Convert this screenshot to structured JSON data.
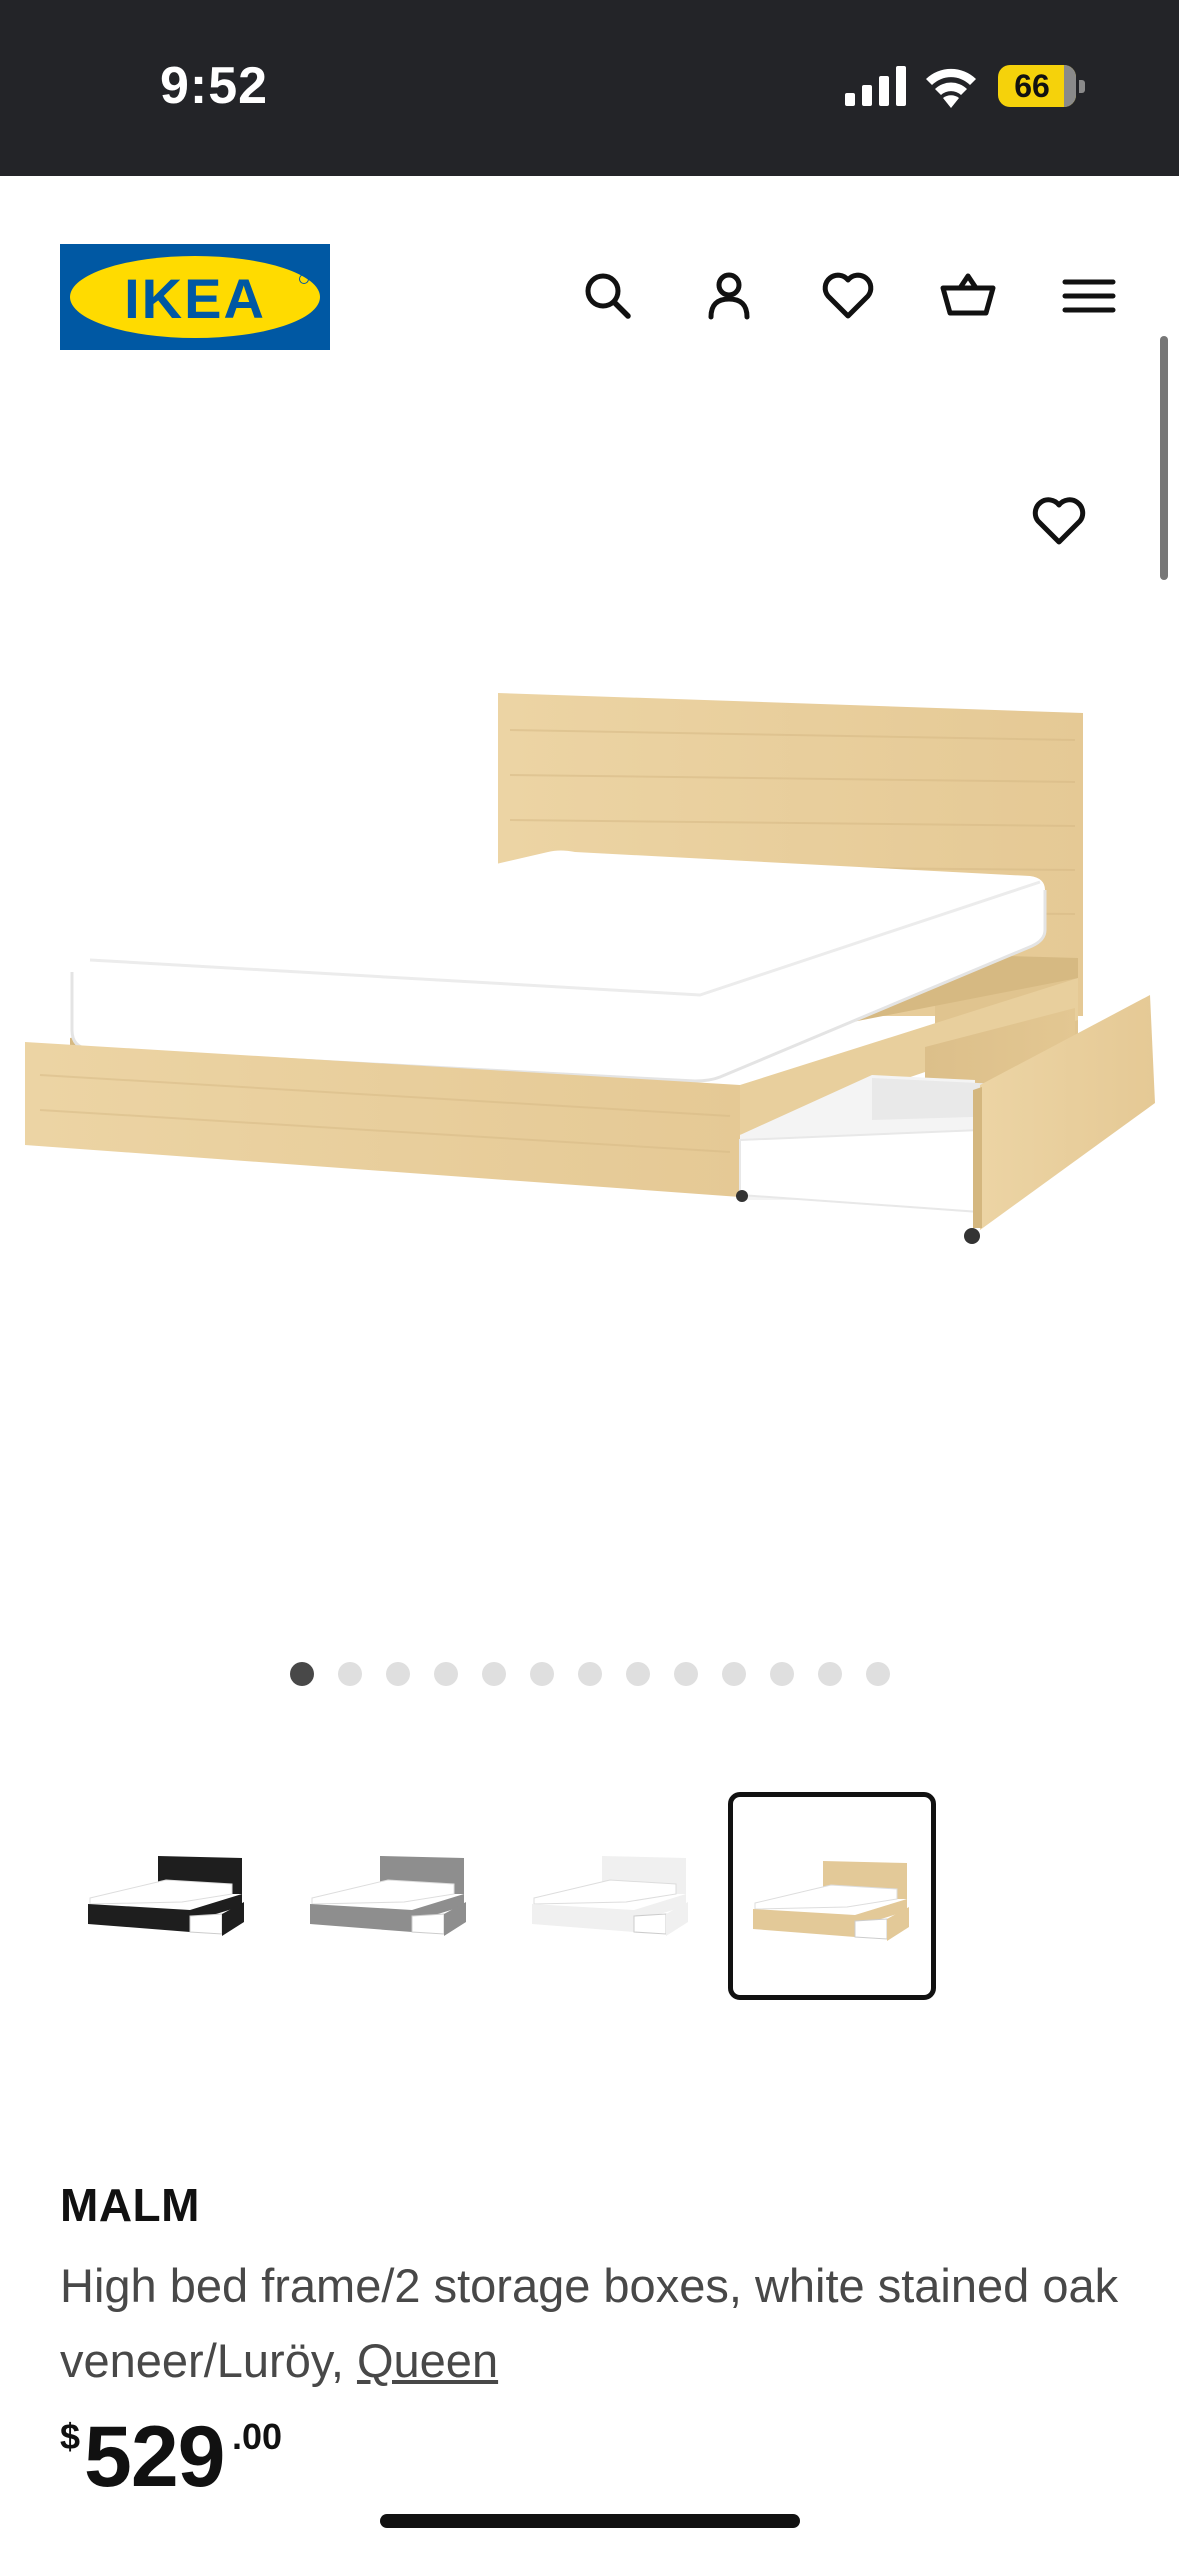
{
  "status_bar": {
    "time": "9:52",
    "battery": "66",
    "icons": [
      "signal-icon",
      "wifi-icon",
      "battery-icon"
    ]
  },
  "header": {
    "logo_text": "IKEA",
    "icons": [
      "search-icon",
      "account-icon",
      "heart-icon",
      "cart-icon",
      "menu-icon"
    ]
  },
  "gallery": {
    "total_images": 13,
    "active_index": 0,
    "wishlist_icon": "heart-icon"
  },
  "variants": [
    {
      "name": "black-brown",
      "color": "#1e1e1e",
      "selected": false
    },
    {
      "name": "gray",
      "color": "#8e8e8e",
      "selected": false
    },
    {
      "name": "white",
      "color": "#f0f0f0",
      "selected": false
    },
    {
      "name": "white stained oak veneer",
      "color": "#e3c998",
      "selected": true
    }
  ],
  "product": {
    "name": "MALM",
    "description": "High bed frame/2 storage boxes, white stained oak veneer/Luröy, ",
    "size": "Queen",
    "price": {
      "currency": "$",
      "integer": "529",
      "decimal": ".00"
    }
  },
  "colors": {
    "status_bar_bg": "#232428",
    "brand_blue": "#0058a3",
    "brand_yellow": "#ffdb00",
    "wood": "#e8cf9f"
  }
}
